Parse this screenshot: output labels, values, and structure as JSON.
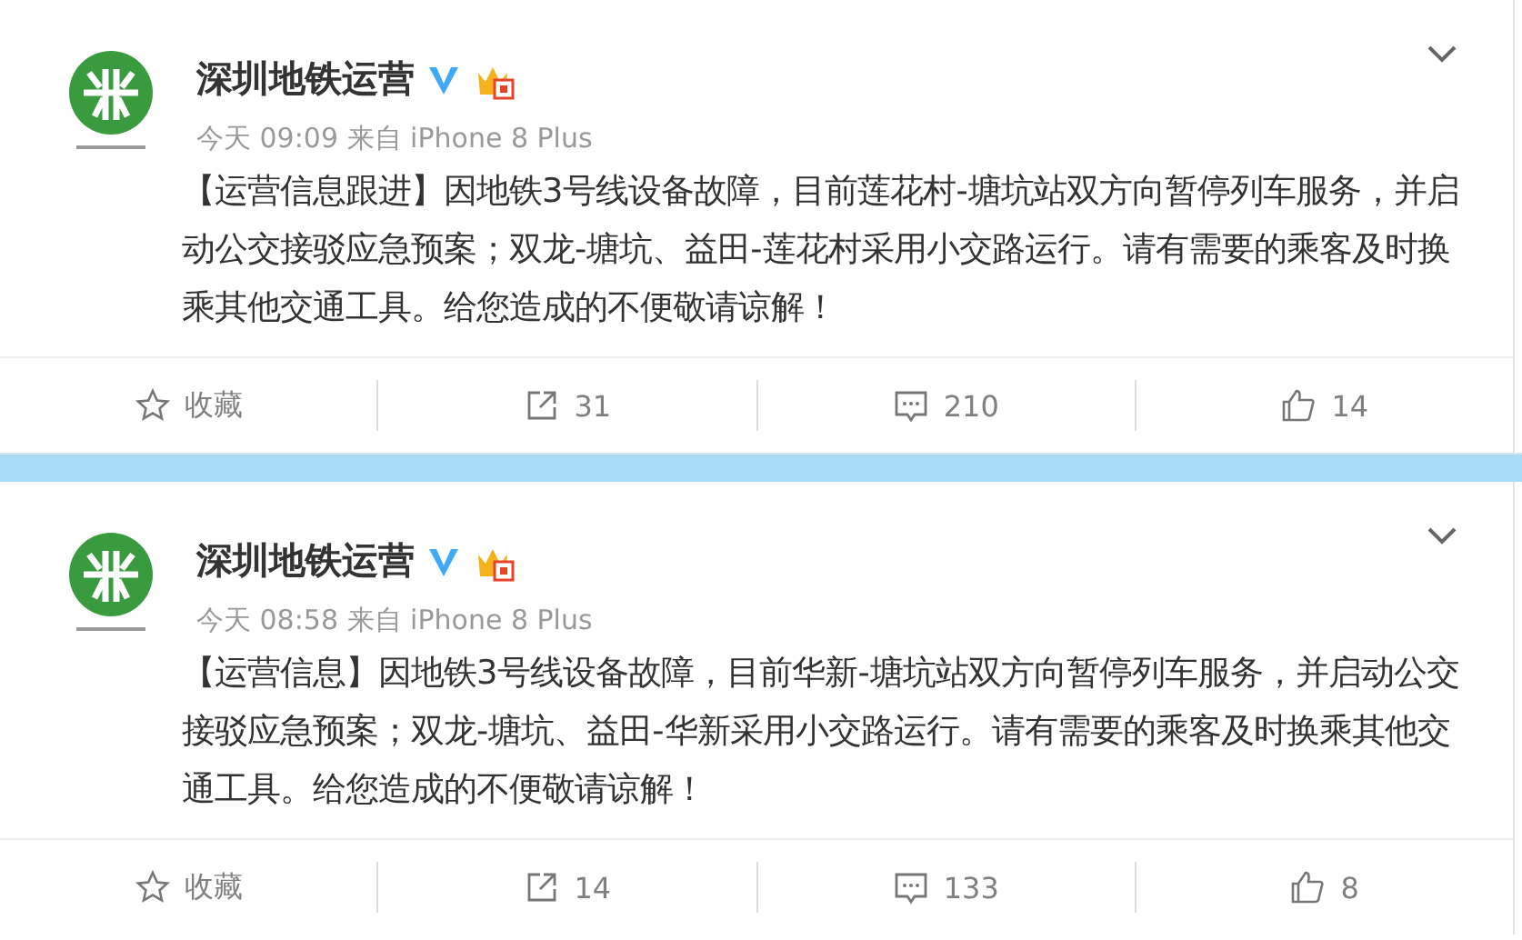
{
  "posts": [
    {
      "author": "深圳地铁运营",
      "time": "今天 09:09",
      "source": "来自 iPhone 8 Plus",
      "text": "【运营信息跟进】因地铁3号线设备故障，目前莲花村-塘坑站双方向暂停列车服务，并启动公交接驳应急预案；双龙-塘坑、益田-莲花村采用小交路运行。请有需要的乘客及时换乘其他交通工具。给您造成的不便敬请谅解！",
      "favorite": "收藏",
      "reposts": "31",
      "comments": "210",
      "likes": "14"
    },
    {
      "author": "深圳地铁运营",
      "time": "今天 08:58",
      "source": "来自 iPhone 8 Plus",
      "text": "【运营信息】因地铁3号线设备故障，目前华新-塘坑站双方向暂停列车服务，并启动公交接驳应急预案；双龙-塘坑、益田-华新采用小交路运行。请有需要的乘客及时换乘其他交通工具。给您造成的不便敬请谅解！",
      "favorite": "收藏",
      "reposts": "14",
      "comments": "133",
      "likes": "8"
    }
  ]
}
